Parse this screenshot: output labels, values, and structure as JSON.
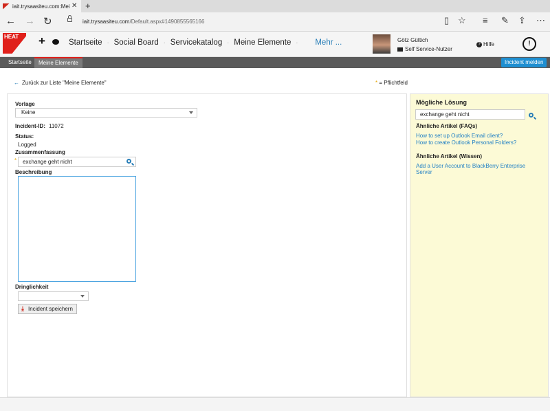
{
  "browser": {
    "tab_title": "iait.trysaasiteu.com:Mei",
    "tab_close": "✕",
    "new_tab": "+",
    "url_domain": "iait.trysaasiteu.com",
    "url_path": "/Default.aspx#1490855565166"
  },
  "app": {
    "logo_text": "HEAT",
    "nav": [
      "Startseite",
      "Social Board",
      "Servicekatalog",
      "Meine Elemente"
    ],
    "nav_more": "Mehr ...",
    "user_name": "Götz Güttich",
    "user_role": "Self Service-Nutzer",
    "help_label": "Hilfe",
    "help_glyph": "?",
    "power_glyph": "!"
  },
  "tabs": {
    "items": [
      "Startseite",
      "Meine Elemente"
    ],
    "active": "Meine Elemente",
    "incident_button": "Incident melden"
  },
  "content": {
    "back_link": "Zurück zur Liste \"Meine Elemente\"",
    "required_note": "= Pflichtfeld",
    "required_mark": "*"
  },
  "form": {
    "vorlage_label": "Vorlage",
    "vorlage_value": "Keine",
    "incident_id_label": "Incident-ID:",
    "incident_id_value": "11072",
    "status_label": "Status:",
    "status_value": "Logged",
    "zusammenfassung_label": "Zusammenfassung",
    "zusammenfassung_value": "exchange geht nicht",
    "beschreibung_label": "Beschreibung",
    "beschreibung_value": "",
    "dringlichkeit_label": "Dringlichkeit",
    "dringlichkeit_value": "",
    "save_button": "Incident speichern"
  },
  "solution": {
    "title": "Mögliche Lösung",
    "search_value": "exchange geht nicht",
    "faq_heading": "Ähnliche Artikel (FAQs)",
    "faq_links": [
      "How to set up Outlook Email client?",
      "How to create Outlook Personal Folders?"
    ],
    "knowledge_heading": "Ähnliche Artikel (Wissen)",
    "knowledge_links": [
      "Add a User Account to BlackBerry Enterprise Server"
    ]
  },
  "colors": {
    "accent_blue": "#1f8fd1",
    "brand_red": "#e0201b",
    "side_panel_bg": "#fcfad6"
  }
}
